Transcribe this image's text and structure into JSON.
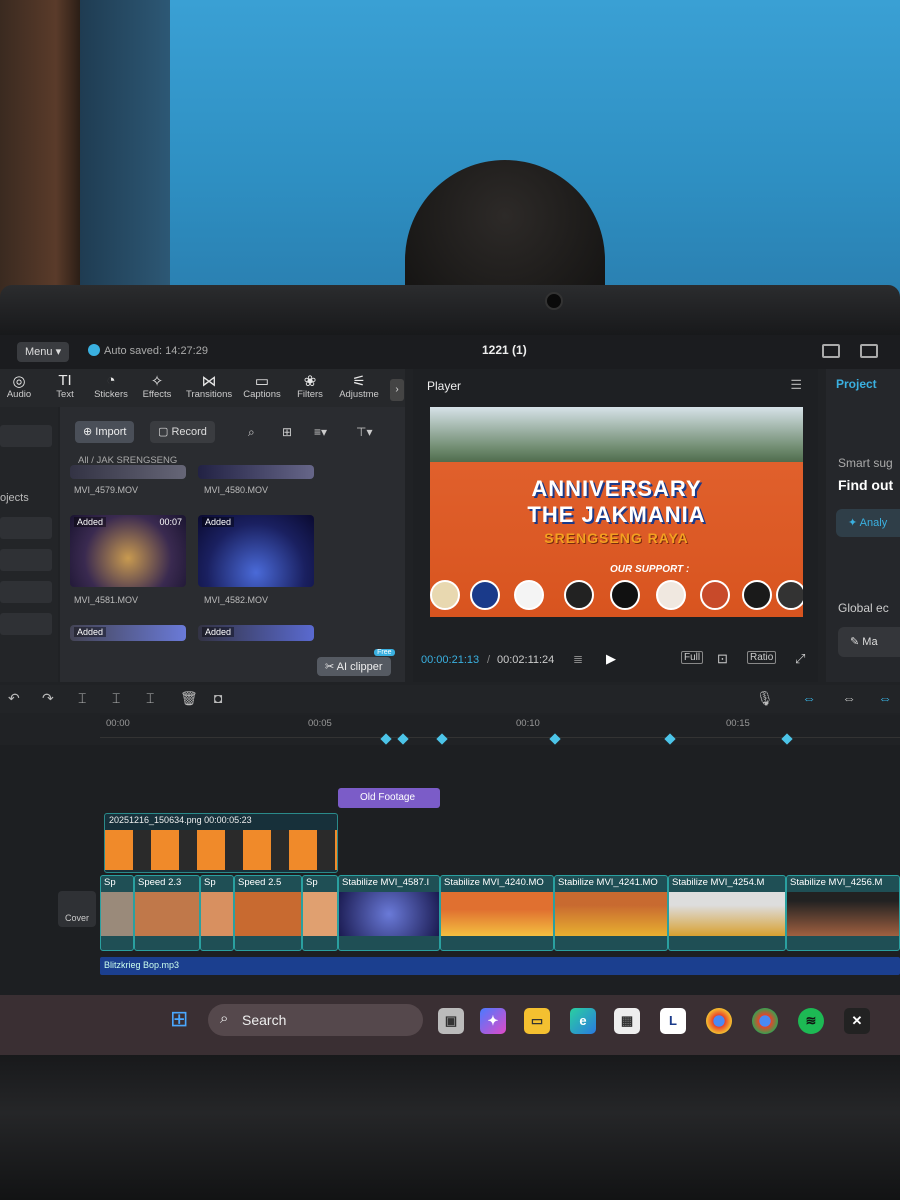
{
  "window": {
    "menu_label": "Menu",
    "autosave": "Auto saved: 14:27:29",
    "project_title": "1221 (1)"
  },
  "toolbar": {
    "items": [
      {
        "label": "Audio",
        "icon": "audio-icon"
      },
      {
        "label": "Text",
        "icon": "text-icon"
      },
      {
        "label": "Stickers",
        "icon": "stickers-icon"
      },
      {
        "label": "Effects",
        "icon": "effects-icon"
      },
      {
        "label": "Transitions",
        "icon": "transitions-icon"
      },
      {
        "label": "Captions",
        "icon": "captions-icon"
      },
      {
        "label": "Filters",
        "icon": "filters-icon"
      },
      {
        "label": "Adjustme",
        "icon": "adjustment-icon"
      }
    ]
  },
  "left_strip": {
    "label": "ojects"
  },
  "media": {
    "import_label": "Import",
    "record_label": "Record",
    "breadcrumb_root": "All",
    "breadcrumb_folder": "JAK SRENGSENG",
    "files": [
      {
        "name": "MVI_4579.MOV",
        "added": "",
        "duration": ""
      },
      {
        "name": "MVI_4580.MOV",
        "added": "",
        "duration": ""
      },
      {
        "name": "MVI_4581.MOV",
        "added": "Added",
        "duration": "00:07"
      },
      {
        "name": "MVI_4582.MOV",
        "added": "Added",
        "duration": ""
      },
      {
        "name": "",
        "added": "Added",
        "duration": ""
      },
      {
        "name": "",
        "added": "Added",
        "duration": ""
      }
    ],
    "ai_clipper_label": "AI clipper",
    "ai_clipper_badge": "Free"
  },
  "player": {
    "title": "Player",
    "banner_line1": "ANNIVERSARY",
    "banner_line2": "THE JAKMANIA",
    "banner_line3": "SRENGSENG RAYA",
    "banner_line4": "OUR SUPPORT :",
    "current_time": "00:00:21:13",
    "total_time": "00:02:11:24",
    "full_label": "Full",
    "ratio_label": "Ratio"
  },
  "right_panel": {
    "tab": "Project",
    "smart_label": "Smart sug",
    "find_label": "Find out",
    "analyze_label": "Analy",
    "global_label": "Global ec",
    "ma_label": "Ma"
  },
  "timeline": {
    "ticks": [
      "00:00",
      "00:05",
      "00:10",
      "00:15"
    ],
    "effect_clip": "Old Footage",
    "overlay_clip_label": "20251216_150634.png  00:00:05:23",
    "cover_label": "Cover",
    "clips": [
      {
        "label": "Sp",
        "color": "#9a8a7a"
      },
      {
        "label": "Speed 2.3",
        "color": "#c0784a"
      },
      {
        "label": "Sp",
        "color": "#d89060"
      },
      {
        "label": "Speed 2.5",
        "color": "#c86a30"
      },
      {
        "label": "Sp",
        "color": "#e0a070"
      },
      {
        "label": "Stabilize   MVI_4587.I",
        "color": "#3a3aa0"
      },
      {
        "label": "Stabilize   MVI_4240.MO",
        "color": "#e07030"
      },
      {
        "label": "Stabilize   MVI_4241.MO",
        "color": "#d8a030"
      },
      {
        "label": "Stabilize   MVI_4254.M",
        "color": "#c8a050"
      },
      {
        "label": "Stabilize   MVI_4256.M",
        "color": "#a06040"
      }
    ],
    "audio_clip": "Blitzkrieg Bop.mp3"
  },
  "taskbar": {
    "search_label": "Search"
  }
}
